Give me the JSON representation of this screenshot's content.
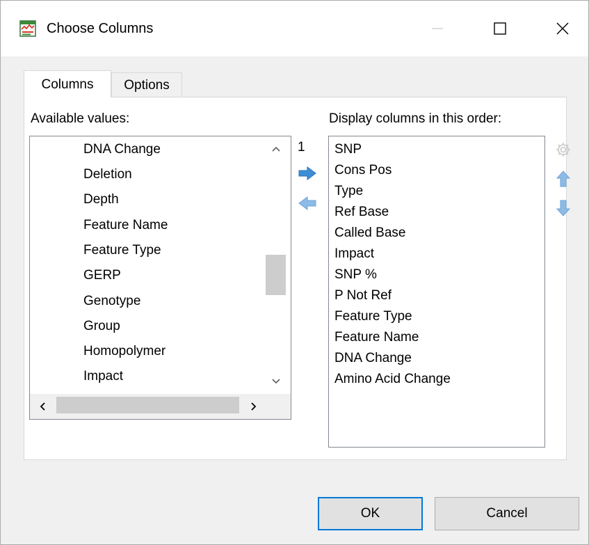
{
  "window": {
    "title": "Choose Columns",
    "icon": "chart-columns-icon"
  },
  "tabs": [
    {
      "label": "Columns",
      "active": true
    },
    {
      "label": "Options",
      "active": false
    }
  ],
  "available": {
    "label": "Available values:",
    "items": [
      "DNA Change",
      "Deletion",
      "Depth",
      "Feature Name",
      "Feature Type",
      "GERP",
      "Genotype",
      "Group",
      "Homopolymer",
      "Impact"
    ]
  },
  "selected_count": "1",
  "display": {
    "label": "Display columns in this order:",
    "items": [
      "SNP",
      "Cons Pos",
      "Type",
      "Ref Base",
      "Called Base",
      "Impact",
      "SNP %",
      "P Not Ref",
      "Feature Type",
      "Feature Name",
      "DNA Change",
      "Amino Acid Change"
    ]
  },
  "buttons": {
    "ok": "OK",
    "cancel": "Cancel"
  },
  "colors": {
    "accent": "#0078d7",
    "arrow_blue": "#3c8fd6",
    "disabled_gear": "#c8c8c8"
  }
}
